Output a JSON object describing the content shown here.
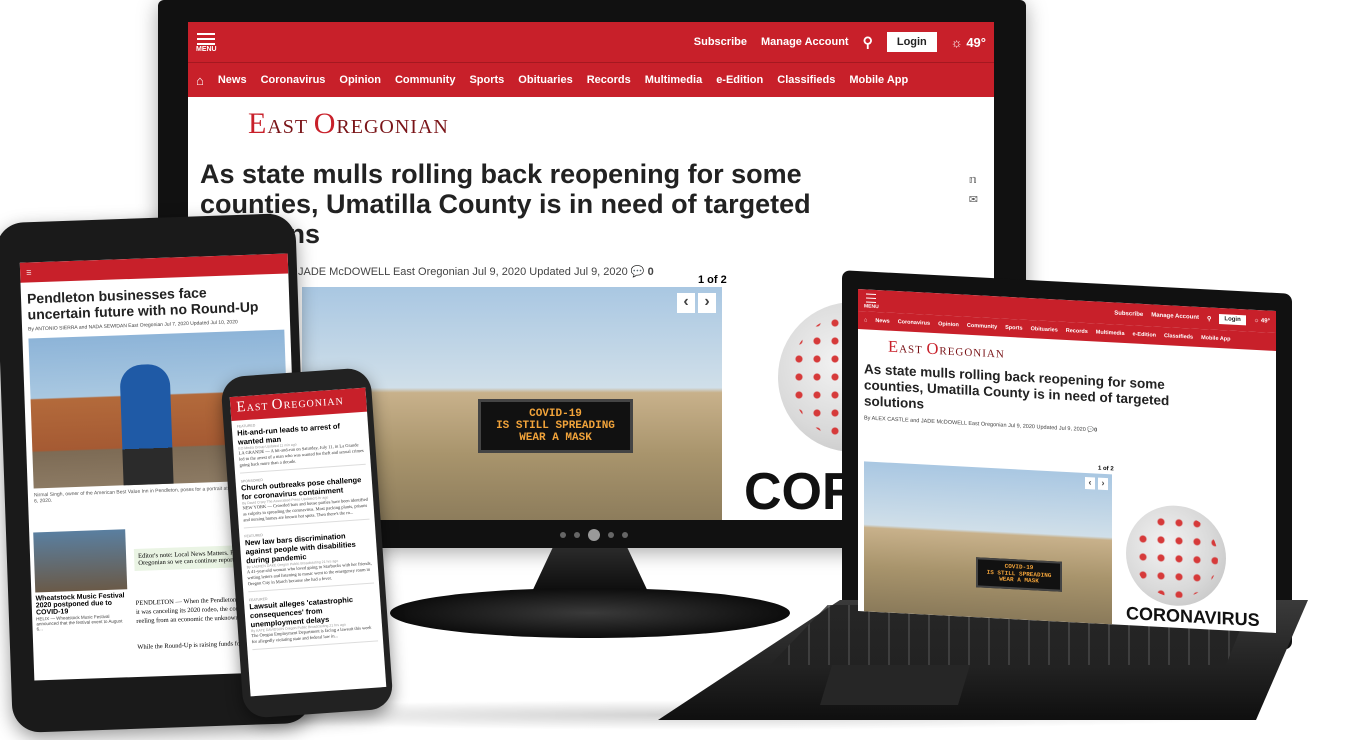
{
  "site": {
    "menu_label": "MENU",
    "subscribe": "Subscribe",
    "manage_account": "Manage Account",
    "login": "Login",
    "weather": "49°",
    "logo": {
      "first_cap": "E",
      "first_rest": "AST",
      "second_cap": "O",
      "second_rest": "REGONIAN"
    },
    "nav": [
      "News",
      "Coronavirus",
      "Opinion",
      "Community",
      "Sports",
      "Obituaries",
      "Records",
      "Multimedia",
      "e-Edition",
      "Classifieds",
      "Mobile App"
    ]
  },
  "desktop": {
    "headline": "As state mulls rolling back reopening for some counties, Umatilla County is in need of targeted solutions",
    "byline": "JADE McDOWELL East Oregonian  Jul 9, 2020 Updated Jul 9, 2020",
    "comments": "0",
    "gallery_count": "1 of 2",
    "sign_text": "COVID-19\nIS STILL SPREADING\nWEAR A MASK",
    "sidebar_text": "CORO"
  },
  "laptop": {
    "headline": "As state mulls rolling back reopening for some counties, Umatilla County is in need of targeted solutions",
    "byline": "By ALEX CASTLE and JADE McDOWELL East Oregonian  Jul 9, 2020 Updated Jul 9, 2020",
    "comments": "0",
    "gallery_count": "1 of 2",
    "sign_text": "COVID-19\nIS STILL SPREADING\nWEAR A MASK",
    "sidebar_text": "CORONAVIRUS"
  },
  "tablet": {
    "headline": "Pendleton businesses face uncertain future with no Round-Up",
    "byline": "By ANTONIO SIERRA and NADA SEWIDAN East Oregonian  Jul 7, 2020 Updated Jul 10, 2020",
    "caption": "Nirmal Singh, owner of the American Best Value Inn in Pendleton, poses for a portrait at the hotel on Monday, July 6, 2020.",
    "editor_note": "Editor's note: Local News Matters. Please support the East Oregonian so we can continue reporting. Thank you.",
    "body1": "PENDLETON — When the Pendleton Round-Up announced it was canceling its 2020 rodeo, the community already reeling from an economic the unknown.",
    "body2": "While the Round-Up is raising funds for",
    "side_headline": "Wheatstock Music Festival 2020 postponed due to COVID-19",
    "side_text": "HELIX — Wheatstock Music Festival announced that the festival event to August 6..."
  },
  "phone": {
    "items": [
      {
        "tag": "FEATURED",
        "title": "Hit-and-run leads to arrest of wanted man",
        "meta": "EO Media Group  Updated 11 min ago",
        "text": "LA GRANDE — A hit-and-run on Saturday, July 11, in La Grande led to the arrest of a man who was wanted for theft and sexual crimes going back more than a decade."
      },
      {
        "tag": "SPONSORED",
        "title": "Church outbreaks pose challenge for coronavirus containment",
        "meta": "By David Crary The Associated Press  Updated 5 hr ago",
        "text": "NEW YORK — Crowded bars and house parties have been identified as culprits in spreading the coronavirus. Most packing plants, prisons and nursing homes are known hot spots. Then there's the ro..."
      },
      {
        "tag": "FEATURED",
        "title": "New law bars discrimination against people with disabilities during pandemic",
        "meta": "By LAUREN DAKE Oregon Public Broadcasting  21 hrs ago",
        "text": "A 41-year-old woman who loved going to Starbucks with her friends, writing letters and listening to music went to the emergency room in Oregon City in March because she had a fever."
      },
      {
        "tag": "FEATURED",
        "title": "Lawsuit alleges 'catastrophic consequences' from unemployment delays",
        "meta": "By KATE DAVIDSON Oregon Public Broadcasting  21 hrs ago",
        "text": "The Oregon Employment Department is facing a lawsuit this week for allegedly violating state and federal law in..."
      }
    ]
  },
  "colors": {
    "brand_red": "#c8202a",
    "logo_dark": "#7a1418"
  }
}
